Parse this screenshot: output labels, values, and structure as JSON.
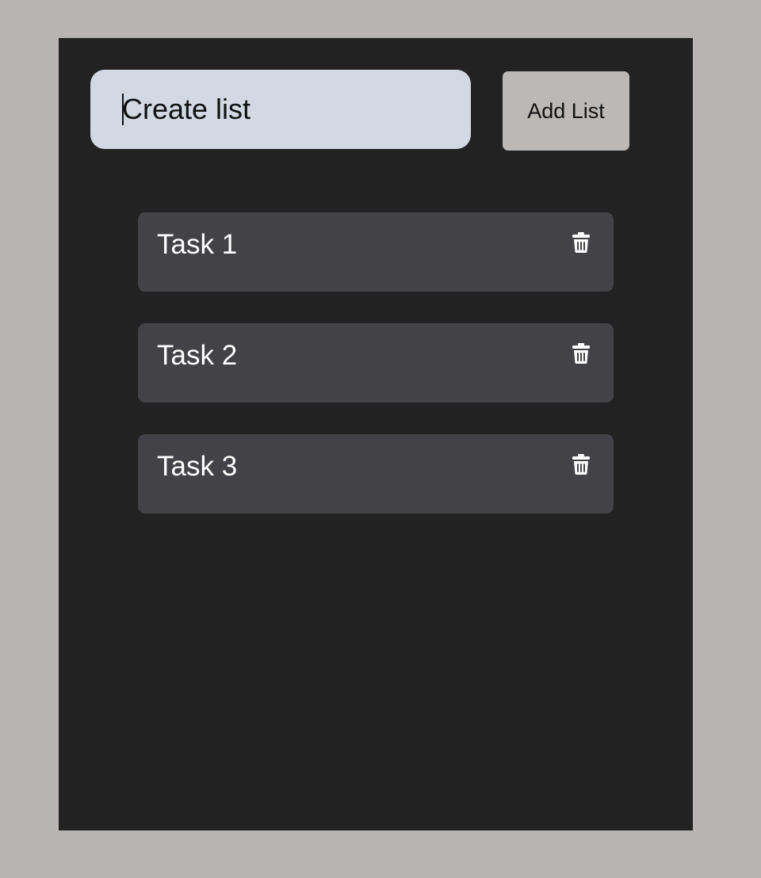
{
  "create_form": {
    "input_placeholder": "Create list",
    "input_value": "",
    "add_button_label": "Add List"
  },
  "tasks": [
    {
      "label": "Task 1",
      "action_icon": "trash-icon"
    },
    {
      "label": "Task 2",
      "action_icon": "trash-icon"
    },
    {
      "label": "Task 3",
      "action_icon": "trash-icon"
    }
  ],
  "colors": {
    "page_background": "#b8b4b3",
    "panel_background": "#222222",
    "input_background": "#d2d9e3",
    "button_background": "#bbb8b5",
    "task_background": "#434247",
    "task_text": "#ffffff"
  }
}
